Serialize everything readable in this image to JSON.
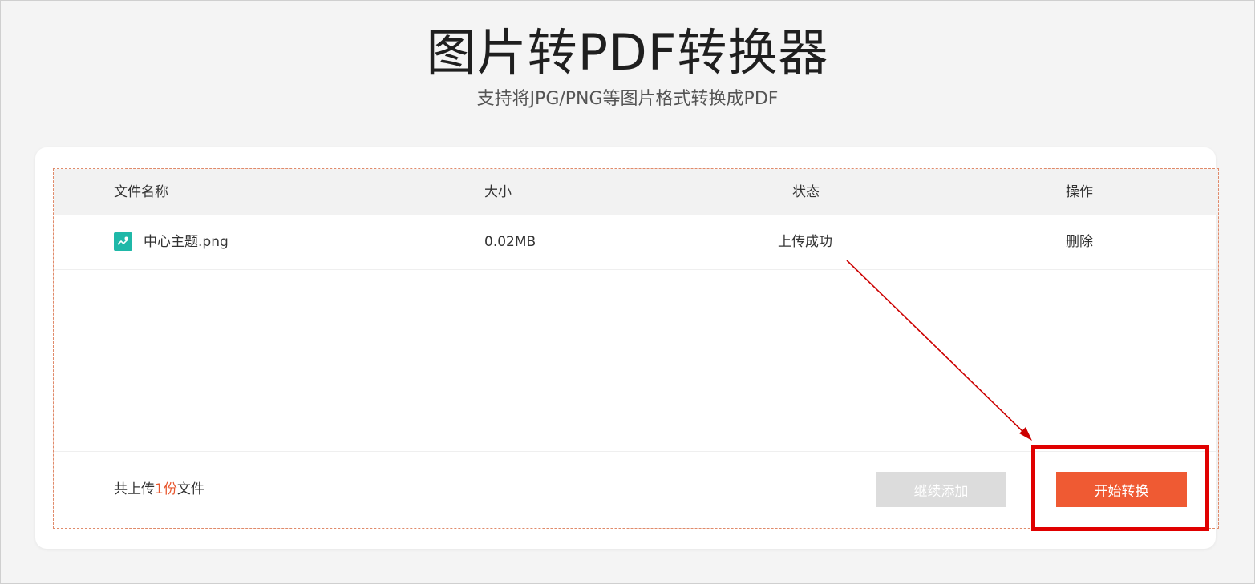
{
  "header": {
    "title": "图片转PDF转换器",
    "subtitle": "支持将JPG/PNG等图片格式转换成PDF"
  },
  "table": {
    "columns": [
      "文件名称",
      "大小",
      "状态",
      "操作"
    ],
    "rows": [
      {
        "icon": "image-file-icon",
        "name": "中心主题.png",
        "size": "0.02MB",
        "status": "上传成功",
        "action": "删除"
      }
    ]
  },
  "footer": {
    "count_prefix": "共上传",
    "count_value": "1份",
    "count_suffix": "文件",
    "add_button_label": "继续添加",
    "start_button_label": "开始转换"
  },
  "colors": {
    "accent": "#ef5a33",
    "count_highlight": "#e8572e",
    "file_icon": "#1fb8a8",
    "annotation": "#e00000",
    "disabled_button": "#dcdcdc"
  }
}
